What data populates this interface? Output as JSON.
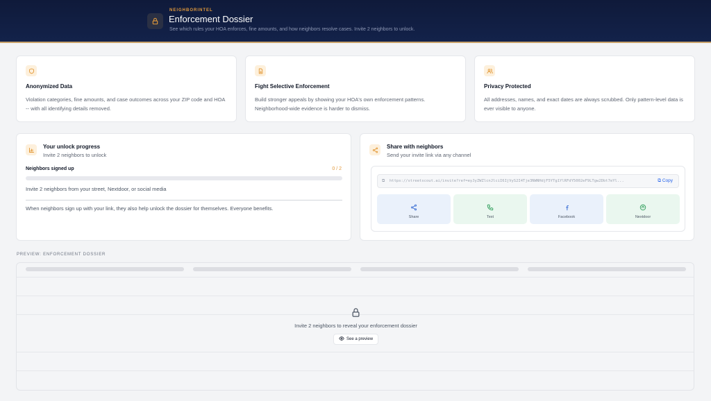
{
  "header": {
    "eyebrow": "NEIGHBORINTEL",
    "title": "Enforcement Dossier",
    "subtitle": "See which rules your HOA enforces, fine amounts, and how neighbors resolve cases. Invite 2 neighbors to unlock."
  },
  "features": [
    {
      "icon": "shield-icon",
      "title": "Anonymized Data",
      "desc": "Violation categories, fine amounts, and case outcomes across your ZIP code and HOA -- with all identifying details removed."
    },
    {
      "icon": "document-icon",
      "title": "Fight Selective Enforcement",
      "desc": "Build stronger appeals by showing your HOA's own enforcement patterns. Neighborhood-wide evidence is harder to dismiss."
    },
    {
      "icon": "users-icon",
      "title": "Privacy Protected",
      "desc": "All addresses, names, and exact dates are always scrubbed. Only pattern-level data is ever visible to anyone."
    }
  ],
  "progress": {
    "title": "Your unlock progress",
    "subtitle": "Invite 2 neighbors to unlock",
    "label": "Neighbors signed up",
    "count": "0 / 2",
    "fraction": 0,
    "hint": "Invite 2 neighbors from your street, Nextdoor, or social media",
    "note": "When neighbors sign up with your link, they also help unlock the dossier for themselves. Everyone benefits."
  },
  "share": {
    "title": "Share with neighbors",
    "subtitle": "Send your invite link via any channel",
    "link": "https://streetscout.ai/invite?ref=eyJyZWZlcnJlciI6IjVyS2I4Tje3NWNHdjF5YTg1YlRFdY5002eF9LTgw2Dbt7eYl...",
    "copy_label": "Copy",
    "channels": [
      {
        "label": "Share",
        "icon": "share-icon",
        "bg": "#eaf1fb"
      },
      {
        "label": "Text",
        "icon": "phone-icon",
        "bg": "#eaf7ef"
      },
      {
        "label": "Facebook",
        "icon": "facebook-icon",
        "bg": "#eaf1fb"
      },
      {
        "label": "Nextdoor",
        "icon": "nextdoor-icon",
        "bg": "#eaf7ef"
      }
    ]
  },
  "preview": {
    "label": "PREVIEW: ENFORCEMENT DOSSIER",
    "message": "Invite 2 neighbors to reveal your enforcement dossier",
    "button_label": "See a preview"
  },
  "colors": {
    "accent": "#e39a3b",
    "header_bg": "#0f1a3a",
    "link": "#2563eb"
  }
}
